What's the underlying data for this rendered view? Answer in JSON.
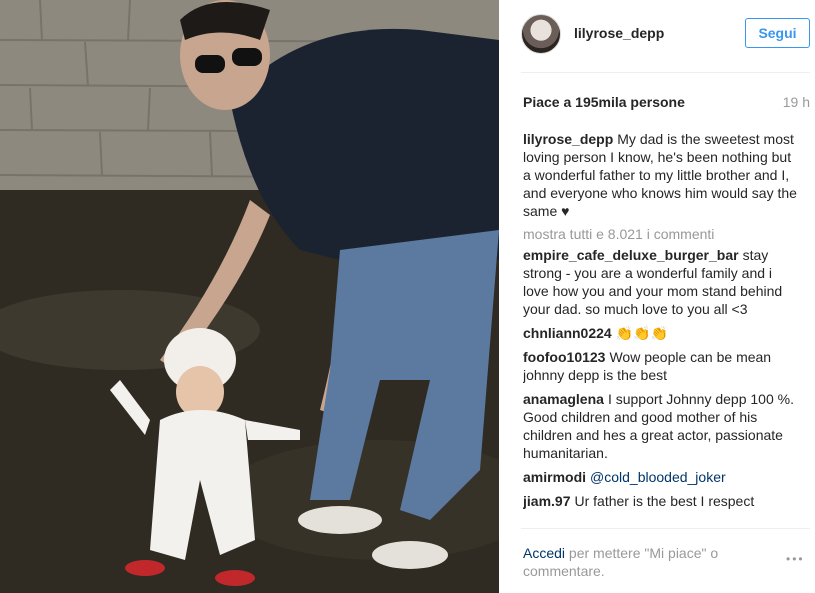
{
  "post": {
    "username": "lilyrose_depp",
    "follow_label": "Segui",
    "likes": "Piace a 195mila persone",
    "time": "19 h",
    "caption_user": "lilyrose_depp",
    "caption_text": "My dad is the sweetest most loving person I know, he's been nothing but a wonderful father to my little brother and I, and everyone who knows him would say the same ♥",
    "view_all_comments": "mostra tutti e 8.021 i commenti"
  },
  "comments": [
    {
      "user": "empire_cafe_deluxe_burger_bar",
      "text": "stay strong - you are a wonderful family and i love how you and your mom stand behind your dad. so much love to you all <3"
    },
    {
      "user": "chnliann0224",
      "text": "👏👏👏"
    },
    {
      "user": "foofoo10123",
      "text": "Wow people can be mean johnny depp is the best"
    },
    {
      "user": "anamaglena",
      "text": "I support Johnny depp 100 %. Good children and good mother of his children and hes a great actor, passionate humanitarian."
    },
    {
      "user": "amirmodi",
      "text": "@cold_blooded_joker"
    },
    {
      "user": "jiam.97",
      "text": "Ur father is the best I respect"
    }
  ],
  "footer": {
    "login_link": "Accedi",
    "login_text": "per mettere \"Mi piace\" o commentare.",
    "more_icon": "•••"
  },
  "colors": {
    "accent": "#3897f0",
    "link": "#003569",
    "muted": "#999999"
  },
  "icons": {
    "more": "more-options-icon"
  }
}
